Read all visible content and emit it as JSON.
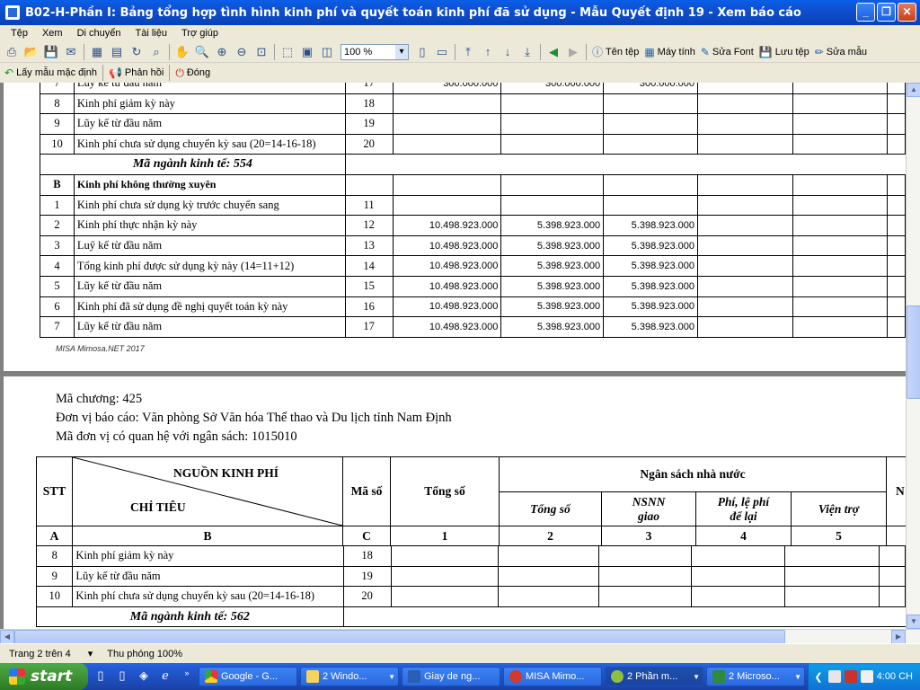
{
  "window": {
    "title": "B02-H-Phần I: Bảng tổng hợp tình hình kinh phí và quyết toán kinh phí đã sử dụng  - Mẫu Quyết định 19 - Xem báo cáo"
  },
  "menu": [
    "Tệp",
    "Xem",
    "Di chuyển",
    "Tài liệu",
    "Trợ giúp"
  ],
  "toolbar": {
    "zoom": "100 %",
    "buttons": [
      "Tên tệp",
      "Máy tính",
      "Sửa Font",
      "Lưu tệp",
      "Sửa mẫu"
    ]
  },
  "toolbar2": {
    "buttons": [
      "Lấy mẫu mặc định",
      "Phản hồi",
      "Đóng"
    ]
  },
  "page1": {
    "partial_row": {
      "stt": "7",
      "name": "Luỹ kế từ đầu năm",
      "ms": "17",
      "v1": "300.000.000",
      "v2": "300.000.000",
      "v3": "300.000.000"
    },
    "rows_a": [
      {
        "stt": "8",
        "name": "Kinh phí giảm kỳ này",
        "ms": "18"
      },
      {
        "stt": "9",
        "name": "Lũy kế từ đầu năm",
        "ms": "19"
      },
      {
        "stt": "10",
        "name": "Kinh phí chưa sử dụng chuyển kỳ sau (20=14-16-18)",
        "ms": "20"
      }
    ],
    "sector": "Mã ngành kinh tế: 554",
    "section_b": {
      "stt": "B",
      "name": "Kinh phí không thường xuyên"
    },
    "rows_b": [
      {
        "stt": "1",
        "name": "Kinh phí chưa sử dụng kỳ trước chuyển sang",
        "ms": "11",
        "v1": "",
        "v2": "",
        "v3": ""
      },
      {
        "stt": "2",
        "name": "Kinh phí thực nhận kỳ này",
        "ms": "12",
        "v1": "10.498.923.000",
        "v2": "5.398.923.000",
        "v3": "5.398.923.000"
      },
      {
        "stt": "3",
        "name": "Luỹ kế từ đầu năm",
        "ms": "13",
        "v1": "10.498.923.000",
        "v2": "5.398.923.000",
        "v3": "5.398.923.000"
      },
      {
        "stt": "4",
        "name": "Tổng kinh phí được sử dụng kỳ này (14=11+12)",
        "ms": "14",
        "v1": "10.498.923.000",
        "v2": "5.398.923.000",
        "v3": "5.398.923.000"
      },
      {
        "stt": "5",
        "name": "Lũy kế từ đầu năm",
        "ms": "15",
        "v1": "10.498.923.000",
        "v2": "5.398.923.000",
        "v3": "5.398.923.000"
      },
      {
        "stt": "6",
        "name": "Kinh phí đã sử dụng đề nghị quyết toán kỳ này",
        "ms": "16",
        "v1": "10.498.923.000",
        "v2": "5.398.923.000",
        "v3": "5.398.923.000"
      },
      {
        "stt": "7",
        "name": "Lũy kế từ đầu năm",
        "ms": "17",
        "v1": "10.498.923.000",
        "v2": "5.398.923.000",
        "v3": "5.398.923.000"
      }
    ],
    "credit": "MISA Mimosa.NET 2017"
  },
  "page2": {
    "info": [
      "Mã chương: 425",
      "Đơn vị báo cáo: Văn phòng Sở Văn hóa Thể thao và Du lịch tỉnh Nam Định",
      "Mã đơn vị có quan hệ với ngân sách: 1015010"
    ],
    "header": {
      "stt": "STT",
      "nguon": "NGUỒN KINH PHÍ",
      "chitieu": "CHỈ TIÊU",
      "maso": "Mã số",
      "tongso": "Tổng số",
      "ngansach": "Ngân sách nhà nước",
      "tongso2": "Tổng số",
      "nsnn": "NSNN giao",
      "phile": "Phí, lệ phí để lại",
      "vientro": "Viện trợ",
      "extra": "N",
      "index": [
        "A",
        "B",
        "C",
        "1",
        "2",
        "3",
        "4",
        "5"
      ]
    },
    "rows": [
      {
        "stt": "8",
        "name": "Kinh phí giảm kỳ này",
        "ms": "18"
      },
      {
        "stt": "9",
        "name": "Lũy kế từ đầu năm",
        "ms": "19"
      },
      {
        "stt": "10",
        "name": "Kinh phí chưa sử dụng chuyển kỳ sau (20=14-16-18)",
        "ms": "20"
      }
    ],
    "sector": "Mã ngành kinh tế: 562"
  },
  "status": {
    "page": "Trang 2 trên 4",
    "zoom": "Thu phóng 100%"
  },
  "taskbar": {
    "start": "start",
    "tasks": [
      "Google - G...",
      "2 Windo...",
      "Giay de ng...",
      "MISA Mimo...",
      "2 Phần m...",
      "2 Microso..."
    ],
    "clock": "4:00 CH"
  }
}
